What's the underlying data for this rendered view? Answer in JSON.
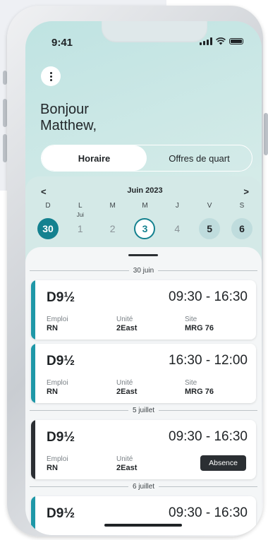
{
  "status_bar": {
    "time": "9:41"
  },
  "greeting": {
    "line1": "Bonjour",
    "line2": "Matthew,"
  },
  "tabs": [
    {
      "label": "Horaire",
      "active": true
    },
    {
      "label": "Offres de quart",
      "active": false
    }
  ],
  "calendar": {
    "prev": "<",
    "next": ">",
    "month": "Juin 2023",
    "days": [
      {
        "weekday": "D",
        "sub": "",
        "num": "30",
        "state": "selected"
      },
      {
        "weekday": "L",
        "sub": "Jui",
        "num": "1",
        "state": ""
      },
      {
        "weekday": "M",
        "sub": "",
        "num": "2",
        "state": ""
      },
      {
        "weekday": "M",
        "sub": "",
        "num": "3",
        "state": "today"
      },
      {
        "weekday": "J",
        "sub": "",
        "num": "4",
        "state": ""
      },
      {
        "weekday": "V",
        "sub": "",
        "num": "5",
        "state": "shift"
      },
      {
        "weekday": "S",
        "sub": "",
        "num": "6",
        "state": "shift"
      }
    ]
  },
  "dates": {
    "d1": "30 juin",
    "d2": "5 juillet",
    "d3": "6 juillet"
  },
  "labels": {
    "emploi": "Emploi",
    "unite": "Unité",
    "site": "Site"
  },
  "shifts": [
    {
      "code": "D9½",
      "hours": "09:30 - 16:30",
      "emploi": "RN",
      "unite": "2East",
      "site": "MRG 76"
    },
    {
      "code": "D9½",
      "hours": "16:30 - 12:00",
      "emploi": "RN",
      "unite": "2East",
      "site": "MRG 76"
    },
    {
      "code": "D9½",
      "hours": "09:30 - 16:30",
      "emploi": "RN",
      "unite": "2East",
      "badge": "Absence"
    },
    {
      "code": "D9½",
      "hours": "09:30 - 16:30"
    }
  ],
  "colors": {
    "accent": "#14818f",
    "stripe": "#1f98a8",
    "stripe_dark": "#2b2f33"
  }
}
